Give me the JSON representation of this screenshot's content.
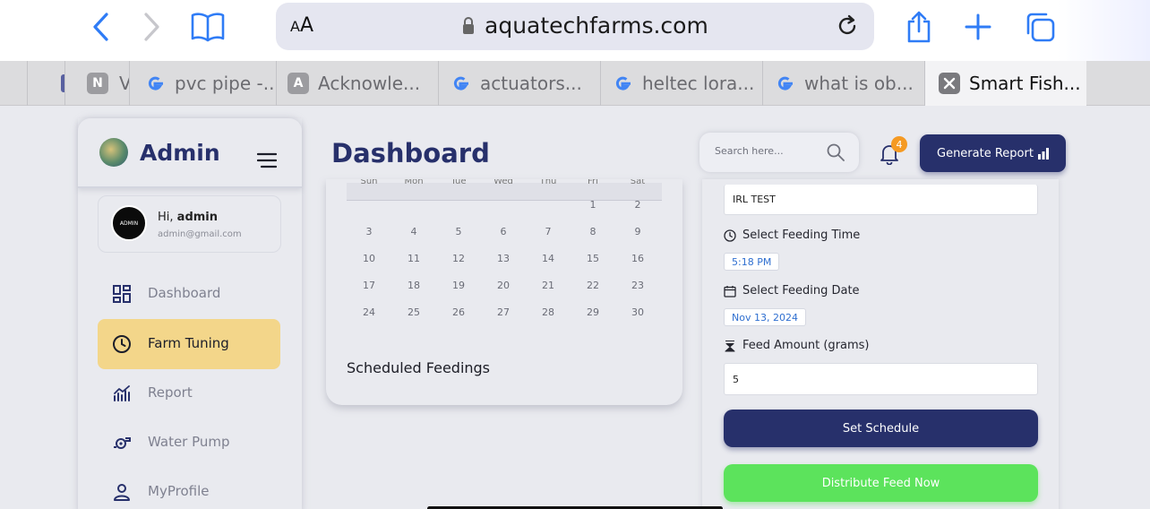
{
  "browser": {
    "text_size_label": "AA",
    "url": "aquatechfarms.com",
    "tabs": [
      {
        "favicon": "default-icon",
        "title": ""
      },
      {
        "favicon": "N",
        "title": "V"
      },
      {
        "favicon": "google-icon",
        "title": "pvc pipe -..."
      },
      {
        "favicon": "A",
        "title": "Acknowle..."
      },
      {
        "favicon": "google-icon",
        "title": "actuators..."
      },
      {
        "favicon": "google-icon",
        "title": "heltec lora..."
      },
      {
        "favicon": "google-icon",
        "title": "what is ob..."
      },
      {
        "favicon": "close-icon",
        "title": "Smart Fish..."
      }
    ]
  },
  "sidebar": {
    "brand": "Admin",
    "user": {
      "greeting": "Hi,",
      "name": "admin",
      "email": "admin@gmail.com",
      "avatar_text": "ADMIN"
    },
    "items": [
      {
        "label": "Dashboard",
        "icon": "dashboard-grid-icon"
      },
      {
        "label": "Farm Tuning",
        "icon": "clock-icon",
        "active": true
      },
      {
        "label": "Report",
        "icon": "report-chart-icon"
      },
      {
        "label": "Water Pump",
        "icon": "water-pump-icon"
      },
      {
        "label": "MyProfile",
        "icon": "person-icon"
      }
    ]
  },
  "header": {
    "title": "Dashboard",
    "search_placeholder": "Search here...",
    "notification_count": "4",
    "generate_report_label": "Generate Report"
  },
  "calendar": {
    "weekdays": [
      "Sun",
      "Mon",
      "Tue",
      "Wed",
      "Thu",
      "Fri",
      "Sat"
    ],
    "weeks": [
      [
        "",
        "",
        "",
        "",
        "",
        "1",
        "2"
      ],
      [
        "3",
        "4",
        "5",
        "6",
        "7",
        "8",
        "9"
      ],
      [
        "10",
        "11",
        "12",
        "13",
        "14",
        "15",
        "16"
      ],
      [
        "17",
        "18",
        "19",
        "20",
        "21",
        "22",
        "23"
      ],
      [
        "24",
        "25",
        "26",
        "27",
        "28",
        "29",
        "30"
      ]
    ],
    "scheduled_title": "Scheduled Feedings"
  },
  "form": {
    "farm_value": "IRL TEST",
    "time_label": "Select Feeding Time",
    "time_value": "5:18 PM",
    "date_label": "Select Feeding Date",
    "date_value": "Nov 13, 2024",
    "amount_label": "Feed Amount (grams)",
    "amount_value": "5",
    "set_schedule_label": "Set Schedule",
    "distribute_label": "Distribute Feed Now"
  },
  "colors": {
    "primary": "#27306b",
    "active_nav": "#f3d68a",
    "success": "#5ce35c",
    "badge": "#f59a23",
    "link": "#2f6fd0"
  }
}
